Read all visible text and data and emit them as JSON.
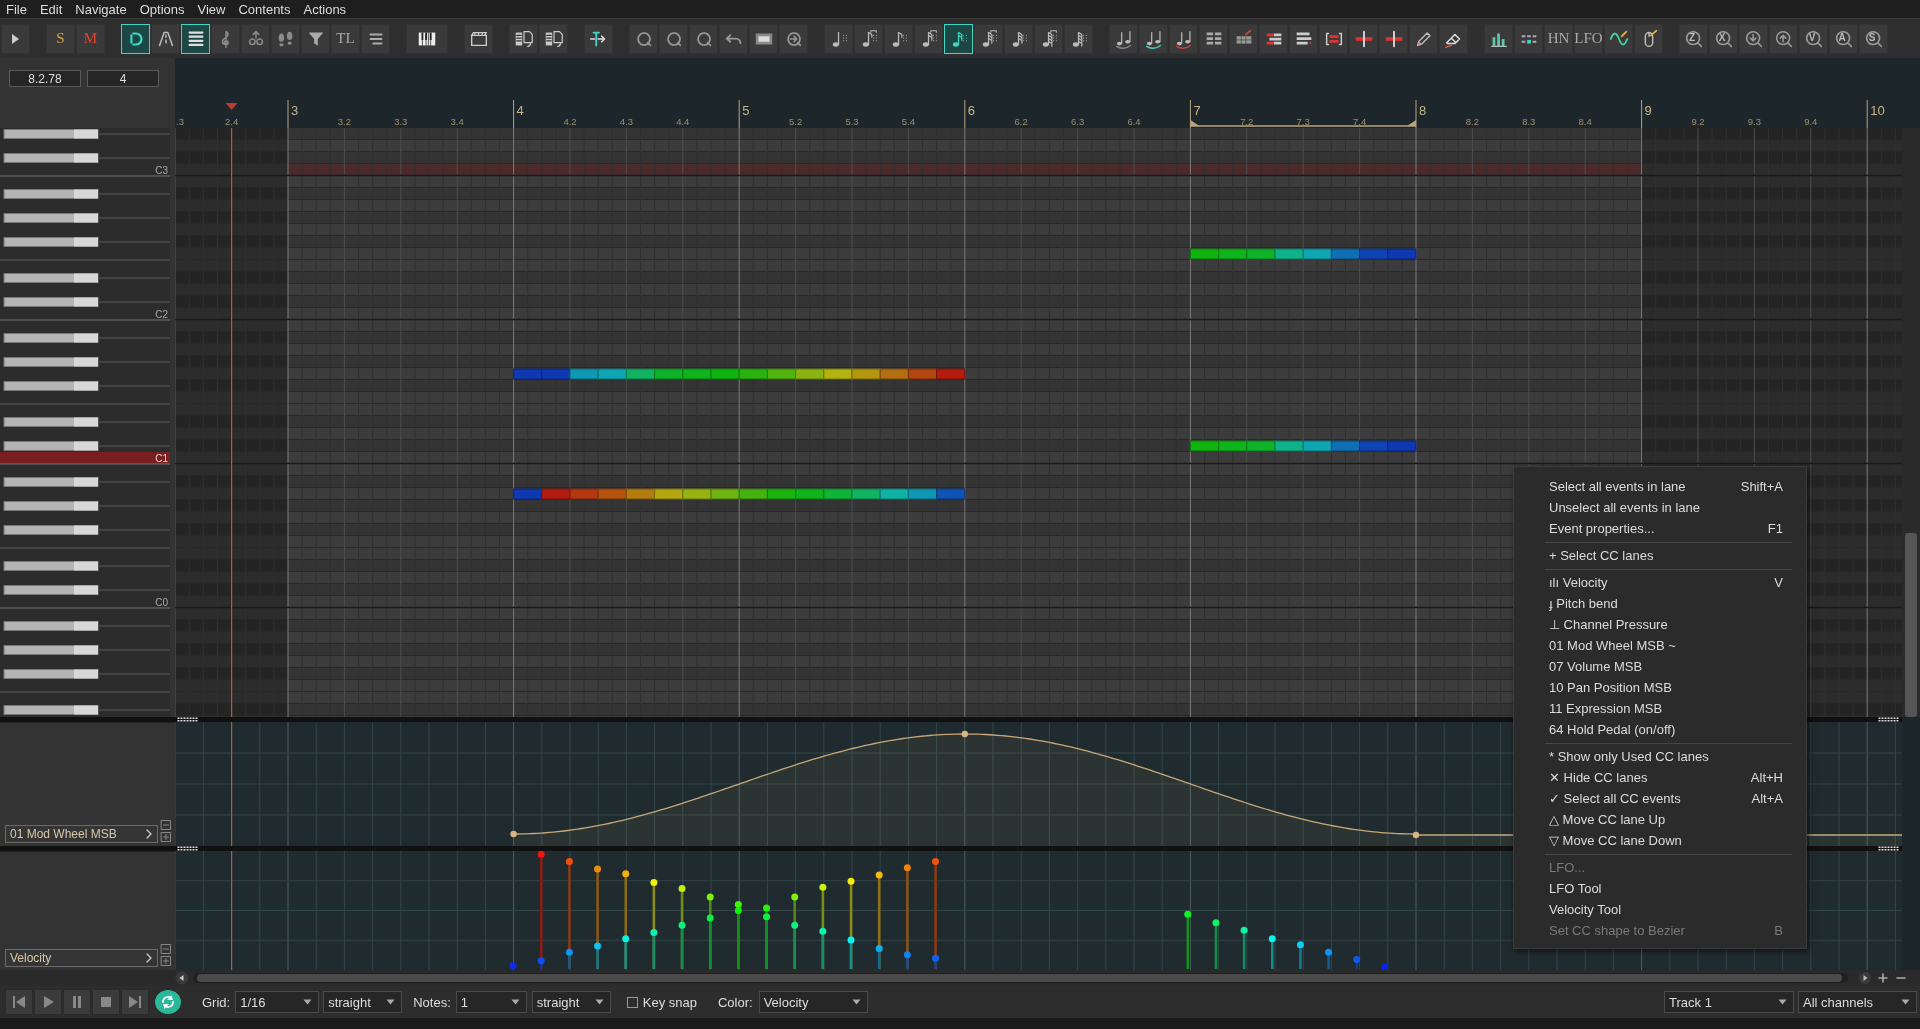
{
  "menu": [
    "File",
    "Edit",
    "Navigate",
    "Options",
    "View",
    "Contents",
    "Actions"
  ],
  "toolbar": [
    [
      {
        "kind": "icon",
        "selected": false
      }
    ],
    [
      {
        "kind": "text",
        "label": "S",
        "color": "#d4a24c",
        "selected": false
      },
      {
        "kind": "text",
        "label": "M",
        "color": "#e0452c",
        "selected": false
      }
    ],
    [
      {
        "kind": "icon",
        "selected": true
      },
      {
        "kind": "icon",
        "selected": false
      },
      {
        "kind": "icon",
        "selected": true
      },
      {
        "kind": "icon",
        "selected": false
      },
      {
        "kind": "icon",
        "selected": false
      },
      {
        "kind": "icon",
        "selected": false
      },
      {
        "kind": "icon",
        "selected": false
      },
      {
        "kind": "text",
        "label": "TL",
        "selected": false
      },
      {
        "kind": "icon",
        "selected": false
      }
    ],
    [
      {
        "kind": "icon",
        "selected": false
      }
    ],
    [
      {
        "kind": "icon",
        "selected": false
      }
    ],
    [
      {
        "kind": "icon",
        "selected": false
      },
      {
        "kind": "icon",
        "selected": false
      }
    ],
    [
      {
        "kind": "icon",
        "selected": false
      }
    ],
    [
      {
        "kind": "icon",
        "selected": false
      },
      {
        "kind": "icon",
        "selected": false
      },
      {
        "kind": "icon",
        "selected": false
      },
      {
        "kind": "icon",
        "selected": false
      },
      {
        "kind": "icon",
        "selected": false
      },
      {
        "kind": "icon",
        "selected": false
      }
    ],
    [
      {
        "kind": "icon",
        "selected": false
      },
      {
        "kind": "icon",
        "selected": false
      },
      {
        "kind": "icon",
        "selected": false
      },
      {
        "kind": "icon",
        "selected": false
      },
      {
        "kind": "icon",
        "selected": true
      },
      {
        "kind": "icon",
        "selected": false
      },
      {
        "kind": "icon",
        "selected": false
      },
      {
        "kind": "icon",
        "selected": false
      },
      {
        "kind": "icon",
        "selected": false
      }
    ],
    [
      {
        "kind": "icon",
        "selected": false
      },
      {
        "kind": "icon",
        "selected": false
      },
      {
        "kind": "icon",
        "selected": false
      },
      {
        "kind": "icon",
        "selected": false
      },
      {
        "kind": "icon",
        "selected": false
      },
      {
        "kind": "icon",
        "selected": false
      },
      {
        "kind": "icon",
        "selected": false
      },
      {
        "kind": "icon",
        "selected": false
      },
      {
        "kind": "icon",
        "selected": false
      },
      {
        "kind": "icon",
        "selected": false
      },
      {
        "kind": "icon",
        "selected": false
      },
      {
        "kind": "icon",
        "selected": false
      }
    ],
    [
      {
        "kind": "icon",
        "selected": false
      },
      {
        "kind": "icon",
        "selected": false
      },
      {
        "kind": "text",
        "label": "HN",
        "selected": false
      },
      {
        "kind": "text",
        "label": "LFO",
        "selected": false
      },
      {
        "kind": "icon",
        "selected": false
      },
      {
        "kind": "icon",
        "selected": false
      }
    ],
    [
      {
        "kind": "zoom",
        "label": "Z",
        "selected": false
      },
      {
        "kind": "zoom",
        "label": "X",
        "selected": false
      },
      {
        "kind": "icon",
        "selected": false
      },
      {
        "kind": "icon",
        "selected": false
      },
      {
        "kind": "zoom",
        "label": "V",
        "selected": false
      },
      {
        "kind": "zoom",
        "label": "A",
        "selected": false
      },
      {
        "kind": "zoom",
        "label": "S",
        "selected": false
      }
    ]
  ],
  "counters": [
    "8.2.78",
    "4"
  ],
  "ruler": [
    {
      "label": ".3",
      "kind": "beat"
    },
    {
      "label": "2.4",
      "kind": "beat"
    },
    {
      "label": "3",
      "kind": "bar"
    },
    {
      "label": "3.2",
      "kind": "beat"
    },
    {
      "label": "3.3",
      "kind": "beat"
    },
    {
      "label": "3.4",
      "kind": "beat"
    },
    {
      "label": "4",
      "kind": "bar"
    },
    {
      "label": "4.2",
      "kind": "beat"
    },
    {
      "label": "4.3",
      "kind": "beat"
    },
    {
      "label": "4.4",
      "kind": "beat"
    },
    {
      "label": "5",
      "kind": "bar"
    },
    {
      "label": "5.2",
      "kind": "beat"
    },
    {
      "label": "5.3",
      "kind": "beat"
    },
    {
      "label": "5.4",
      "kind": "beat"
    },
    {
      "label": "6",
      "kind": "bar"
    },
    {
      "label": "6.2",
      "kind": "beat"
    },
    {
      "label": "6.3",
      "kind": "beat"
    },
    {
      "label": "6.4",
      "kind": "beat"
    },
    {
      "label": "7",
      "kind": "bar"
    },
    {
      "label": "7.2",
      "kind": "beat"
    },
    {
      "label": "7.3",
      "kind": "beat"
    },
    {
      "label": "7.4",
      "kind": "beat"
    },
    {
      "label": "8",
      "kind": "bar"
    },
    {
      "label": "8.2",
      "kind": "beat"
    },
    {
      "label": "8.3",
      "kind": "beat"
    },
    {
      "label": "8.4",
      "kind": "beat"
    },
    {
      "label": "9",
      "kind": "bar"
    },
    {
      "label": "9.2",
      "kind": "beat"
    },
    {
      "label": "9.3",
      "kind": "beat"
    },
    {
      "label": "9.4",
      "kind": "beat"
    },
    {
      "label": "10",
      "kind": "bar"
    }
  ],
  "keys": [
    {
      "label": "C3",
      "selected": false
    },
    {
      "label": "C2",
      "selected": false
    },
    {
      "label": "C1",
      "selected": true
    },
    {
      "label": "C0",
      "selected": false
    }
  ],
  "lanes": [
    {
      "name": "01 Mod Wheel MSB"
    },
    {
      "name": "Velocity"
    }
  ],
  "transport": [
    {
      "selected": false
    },
    {
      "selected": false
    },
    {
      "selected": false
    },
    {
      "selected": false
    },
    {
      "selected": false
    },
    {
      "selected": true
    }
  ],
  "grid": {
    "label": "Grid:",
    "value": "1/16",
    "mode": "straight"
  },
  "notes": {
    "label": "Notes:",
    "value": "1",
    "mode": "straight"
  },
  "key_snap": {
    "label": "Key snap",
    "checked": false
  },
  "color": {
    "label": "Color:",
    "value": "Velocity"
  },
  "track": "Track 1",
  "channels": "All channels",
  "context_menu": [
    {
      "items": [
        {
          "label": "Select all events in lane",
          "shortcut": "Shift+A",
          "disabled": false
        },
        {
          "label": "Unselect all events in lane",
          "disabled": false
        },
        {
          "label": "Event properties...",
          "shortcut": "F1",
          "disabled": false
        }
      ]
    },
    {
      "items": [
        {
          "icon": "+",
          "label": "Select CC lanes",
          "disabled": false
        }
      ]
    },
    {
      "items": [
        {
          "icon": "ılı",
          "label": "Velocity",
          "shortcut": "V",
          "disabled": false
        },
        {
          "icon": "ɟ",
          "label": "Pitch bend",
          "disabled": false
        },
        {
          "icon": "⊥",
          "label": "Channel Pressure",
          "disabled": false
        },
        {
          "label": "01 Mod Wheel MSB ~",
          "disabled": false
        },
        {
          "label": "07 Volume MSB",
          "disabled": false
        },
        {
          "label": "10 Pan Position MSB",
          "disabled": false
        },
        {
          "label": "11 Expression MSB",
          "disabled": false
        },
        {
          "label": "64 Hold Pedal (on/off)",
          "disabled": false
        }
      ]
    },
    {
      "items": [
        {
          "icon": "*",
          "label": "Show only Used CC lanes",
          "disabled": false
        },
        {
          "icon": "✕",
          "label": "Hide CC lanes",
          "shortcut": "Alt+H",
          "disabled": false
        },
        {
          "icon": "✓",
          "label": "Select all CC events",
          "shortcut": "Alt+A",
          "disabled": false
        },
        {
          "icon": "△",
          "label": "Move CC lane Up",
          "disabled": false
        },
        {
          "icon": "▽",
          "label": "Move CC lane Down",
          "disabled": false
        }
      ]
    },
    {
      "items": [
        {
          "label": "LFO...",
          "disabled": true
        },
        {
          "label": "LFO Tool",
          "disabled": false
        },
        {
          "label": "Velocity Tool",
          "disabled": false
        },
        {
          "label": "Set CC shape to Bezier",
          "shortcut": "B",
          "disabled": true
        }
      ]
    }
  ]
}
